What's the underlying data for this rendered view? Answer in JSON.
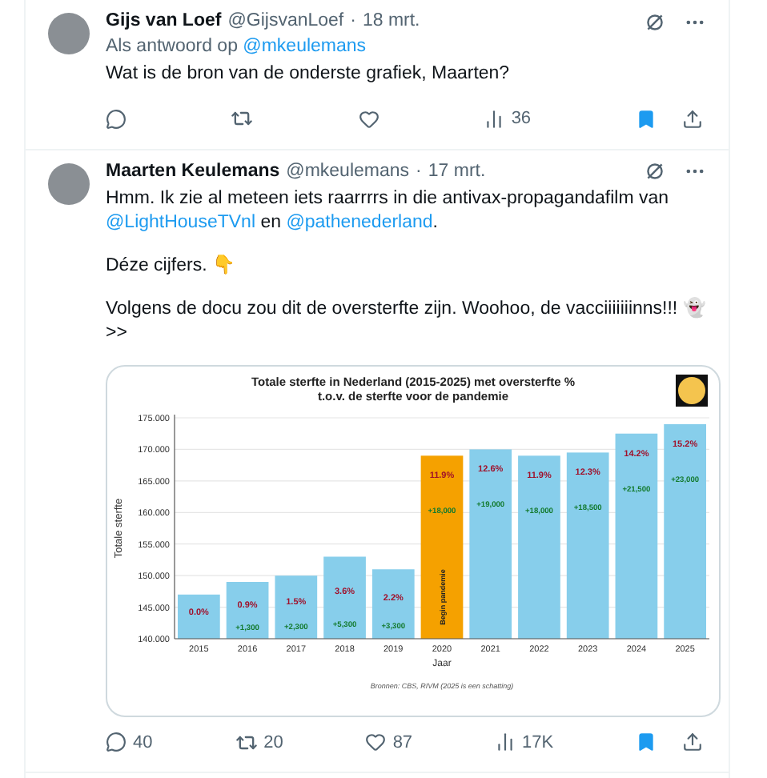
{
  "tweets": [
    {
      "author": "Gijs van Loef",
      "handle": "@GijsvanLoef",
      "separator": "·",
      "date": "18 mrt.",
      "reply_label": "Als antwoord op",
      "reply_to": "@mkeulemans",
      "paragraphs": [
        [
          {
            "kind": "text",
            "text": "Wat is de bron van de onderste grafiek, Maarten?"
          }
        ]
      ],
      "stats": {
        "views": "36"
      },
      "bookmarked": true
    },
    {
      "author": "Maarten Keulemans",
      "handle": "@mkeulemans",
      "separator": "·",
      "date": "17 mrt.",
      "paragraphs": [
        [
          {
            "kind": "text",
            "text": "Hmm. Ik zie al meteen iets raarrrrs in die antivax-propagandafilm van "
          },
          {
            "kind": "link",
            "text": "@LightHouseTVnl"
          },
          {
            "kind": "text",
            "text": " en "
          },
          {
            "kind": "link",
            "text": "@pathenederland"
          },
          {
            "kind": "text",
            "text": "."
          }
        ],
        [
          {
            "kind": "text",
            "text": "Déze cijfers. 👇"
          }
        ],
        [
          {
            "kind": "text",
            "text": "Volgens de docu zou dit de oversterfte zijn. Woohoo, de vacciiiiiiinns!!! 👻 >>"
          }
        ]
      ],
      "chart_data": {
        "type": "bar",
        "title": "Totale sterfte in Nederland (2015-2025) met oversterfte %",
        "subtitle": "t.o.v. de sterfte voor de pandemie",
        "xlabel": "Jaar",
        "ylabel": "Totale sterfte",
        "categories": [
          "2015",
          "2016",
          "2017",
          "2018",
          "2019",
          "2020",
          "2021",
          "2022",
          "2023",
          "2024",
          "2025"
        ],
        "stacked": true,
        "series": [
          {
            "color": "#87ceeb",
            "values": [
              147,
              149,
              150,
              153,
              151,
              null,
              170,
              169,
              169.5,
              172.5,
              174
            ]
          },
          {
            "color": "#f5a100",
            "values": [
              null,
              null,
              null,
              null,
              null,
              169,
              null,
              null,
              null,
              null,
              null
            ]
          }
        ],
        "ylim": [
          140,
          175
        ],
        "yticks": [
          {
            "value": 140,
            "label": "140.000"
          },
          {
            "value": 145,
            "label": "145.000"
          },
          {
            "value": 150,
            "label": "150.000"
          },
          {
            "value": 155,
            "label": "155.000"
          },
          {
            "value": 160,
            "label": "160.000"
          },
          {
            "value": 165,
            "label": "165.000"
          },
          {
            "value": 170,
            "label": "170.000"
          },
          {
            "value": 175,
            "label": "175.000"
          }
        ],
        "value_labels": [
          "0.0%",
          "0.9%",
          "1.5%",
          "3.6%",
          "2.2%",
          "11.9%",
          "12.6%",
          "11.9%",
          "12.3%",
          "14.2%",
          "15.2%"
        ],
        "grid": true,
        "annotations": [
          "Begin pandemie"
        ]
      },
      "chart_bar_notes": [
        "+1,300",
        "+2,300",
        "+5,300",
        "+3,300",
        "+18,000",
        "+19,000",
        "+18,000",
        "+18,500",
        "+21,500",
        "+23,000"
      ],
      "chart_footnote": "Bronnen: CBS, RIVM (2025 is een schatting)",
      "stats": {
        "replies": "40",
        "reposts": "20",
        "likes": "87",
        "views": "17K"
      },
      "bookmarked": true
    }
  ]
}
